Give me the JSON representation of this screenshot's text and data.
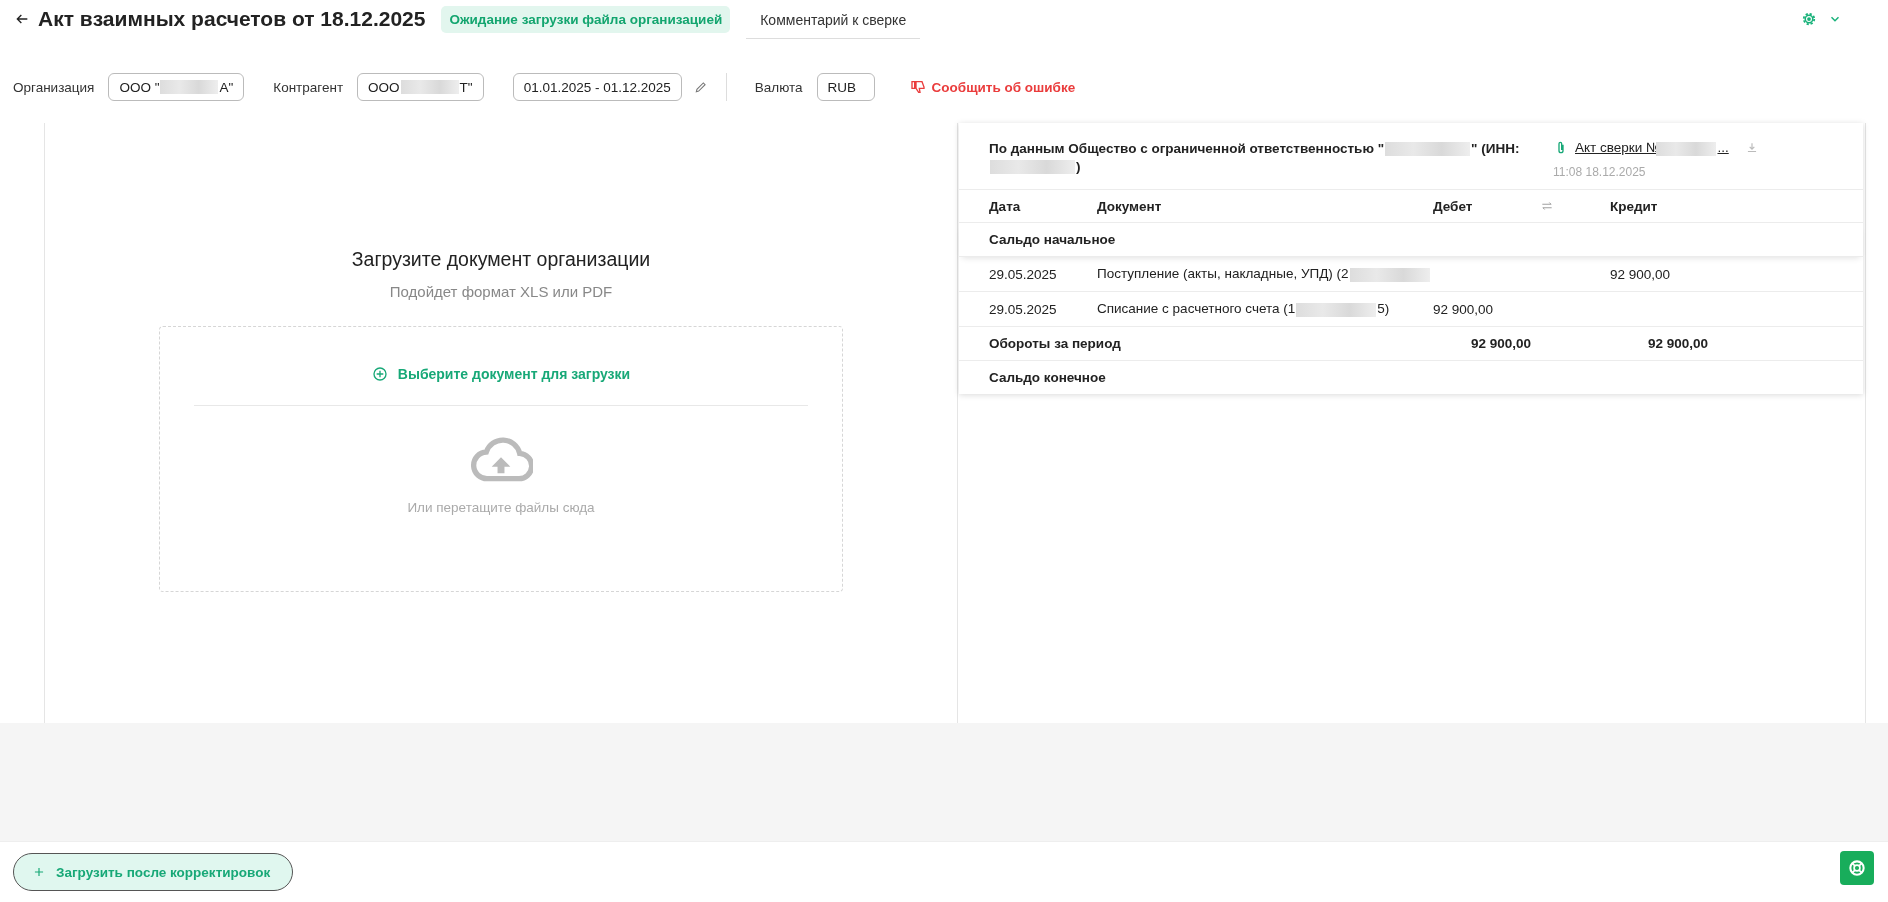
{
  "header": {
    "title": "Акт взаимных расчетов от 18.12.2025",
    "status": "Ожидание загрузки файла организацией",
    "tabs": [
      {
        "label": "Комментарий к сверке",
        "selected": false
      }
    ]
  },
  "filters": [
    {
      "kind": "party",
      "label": "Организация",
      "value": [
        {
          "text": "ООО \""
        },
        {
          "kind": "redacted"
        },
        {
          "text": "А\""
        }
      ]
    },
    {
      "kind": "party",
      "label": "Контрагент",
      "value": [
        {
          "text": "ООО "
        },
        {
          "kind": "redacted"
        },
        {
          "text": "Т\""
        }
      ]
    },
    {
      "kind": "period",
      "value": [
        {
          "text": "01.01.2025 - 01.12.2025"
        }
      ]
    },
    {
      "kind": "currency",
      "label": "Валюта",
      "value": [
        {
          "text": "RUB"
        }
      ]
    }
  ],
  "report_button": "Сообщить об ошибке",
  "upload": {
    "title": "Загрузите документ организации",
    "hint": "Подойдет формат XLS или PDF",
    "choose": "Выберите документ для загрузки",
    "drop": "Или перетащите файлы сюда"
  },
  "counterparty_data": {
    "source": [
      {
        "text": "По данным Общество с ограниченной ответственностью \""
      },
      {
        "kind": "redacted"
      },
      {
        "text": "\" (ИНН: "
      },
      {
        "kind": "redacted"
      },
      {
        "text": ")"
      }
    ],
    "file_link": [
      {
        "text": "Акт сверки №"
      },
      {
        "kind": "redacted"
      },
      {
        "text": "..."
      }
    ],
    "file_time": "11:08 18.12.2025",
    "columns": [
      "Дата",
      "Документ",
      "Дебет",
      "Кредит"
    ],
    "rows": [
      {
        "kind": "balance",
        "label": "Сальдо начальное"
      },
      {
        "kind": "entry",
        "date": "29.05.2025",
        "document": [
          {
            "text": "Поступление (акты, накладные, УПД) (2"
          },
          {
            "kind": "redacted"
          }
        ],
        "credit": "92 900,00"
      },
      {
        "kind": "entry",
        "date": "29.05.2025",
        "document": [
          {
            "text": "Списание с расчетного счета (1"
          },
          {
            "kind": "redacted"
          },
          {
            "text": "5)"
          }
        ],
        "debit": "92 900,00"
      },
      {
        "kind": "total",
        "label": "Обороты за период",
        "debit": "92 900,00",
        "credit": "92 900,00"
      },
      {
        "kind": "balance",
        "label": "Сальдо конечное"
      }
    ]
  },
  "footer_button": "Загрузить после корректировок"
}
